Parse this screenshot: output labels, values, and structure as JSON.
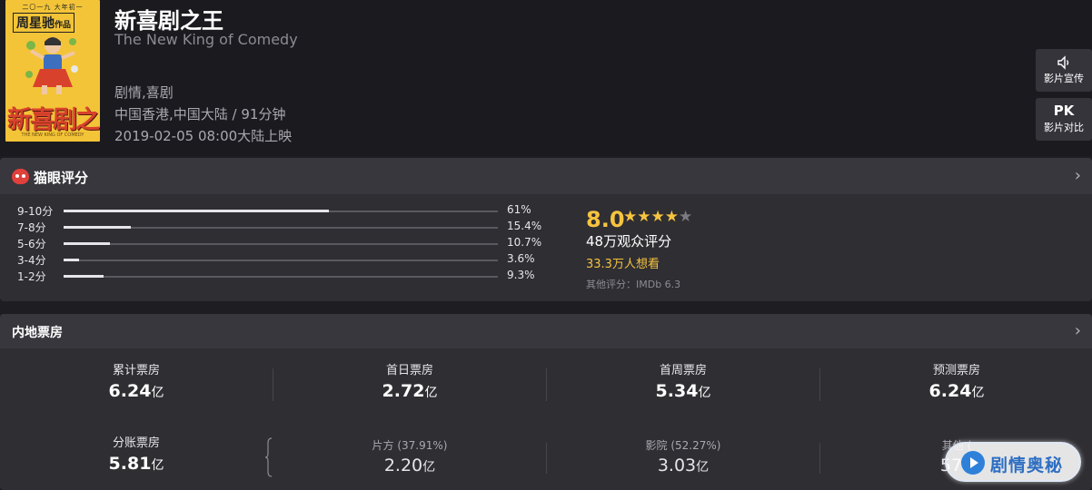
{
  "movie": {
    "poster": {
      "top_text": "二〇一九 大年初一",
      "author": "周星驰",
      "author_suffix": "作品",
      "title_art": "新喜剧之王",
      "bottom_text": "THE NEW KING OF COMEDY"
    },
    "title": "新喜剧之王",
    "english_title": "The New King of Comedy",
    "genres": "剧情,喜剧",
    "origin_duration": "中国香港,中国大陆 / 91分钟",
    "release": "2019-02-05 08:00大陆上映"
  },
  "side_buttons": [
    {
      "icon": "🔈",
      "label": "影片宣传"
    },
    {
      "icon": "PK",
      "label": "影片对比"
    }
  ],
  "rating": {
    "header": "猫眼评分",
    "chevron": "›",
    "distribution": [
      {
        "label": "9-10分",
        "percent_text": "61%",
        "fraction": 0.61
      },
      {
        "label": "7-8分",
        "percent_text": "15.4%",
        "fraction": 0.154
      },
      {
        "label": "5-6分",
        "percent_text": "10.7%",
        "fraction": 0.107
      },
      {
        "label": "3-4分",
        "percent_text": "3.6%",
        "fraction": 0.036
      },
      {
        "label": "1-2分",
        "percent_text": "9.3%",
        "fraction": 0.093
      }
    ],
    "score": "8.0",
    "stars_filled": 4,
    "stars_total": 5,
    "votes": "48万观众评分",
    "wish": "33.3万人想看",
    "other": "其他评分：IMDb 6.3"
  },
  "box_office": {
    "header": "内地票房",
    "chevron": "›",
    "stats": [
      {
        "label": "累计票房",
        "value": "6.24",
        "unit": "亿"
      },
      {
        "label": "首日票房",
        "value": "2.72",
        "unit": "亿"
      },
      {
        "label": "首周票房",
        "value": "5.34",
        "unit": "亿"
      },
      {
        "label": "预测票房",
        "value": "6.24",
        "unit": "亿"
      }
    ],
    "split": {
      "label": "分账票房",
      "value": "5.81",
      "unit": "亿"
    },
    "split_parts": [
      {
        "label": "片方 (37.91%)",
        "value": "2.20",
        "unit": "亿"
      },
      {
        "label": "影院 (52.27%)",
        "value": "3.03",
        "unit": "亿"
      },
      {
        "label": "其他 (",
        "value": "570",
        "unit": ""
      }
    ]
  },
  "watermark": "剧情奥秘",
  "colors": {
    "accent": "#f6c33f",
    "background": "#1e1d22",
    "panel": "#2f2e33",
    "logo_red": "#e1403b"
  }
}
